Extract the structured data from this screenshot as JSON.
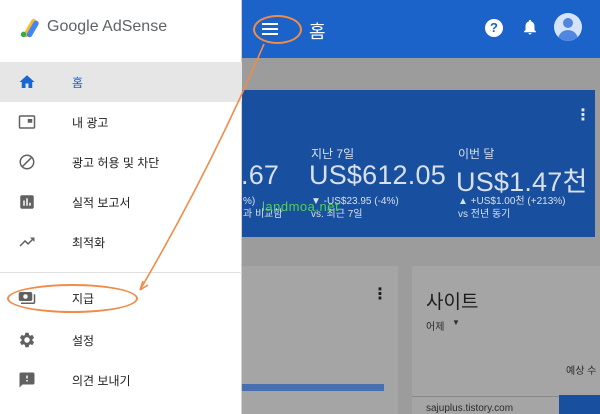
{
  "app": {
    "logo_text": "Google AdSense",
    "page_title": "홈"
  },
  "nav": {
    "items": [
      {
        "label": "홈",
        "icon": "home-icon",
        "active": true
      },
      {
        "label": "내 광고",
        "icon": "ads-icon"
      },
      {
        "label": "광고 허용 및 차단",
        "icon": "block-icon"
      },
      {
        "label": "실적 보고서",
        "icon": "report-icon"
      },
      {
        "label": "최적화",
        "icon": "trending-icon"
      },
      {
        "label": "지급",
        "icon": "payment-icon"
      },
      {
        "label": "설정",
        "icon": "settings-icon"
      },
      {
        "label": "의견 보내기",
        "icon": "feedback-icon"
      }
    ]
  },
  "stats": [
    {
      "label": "",
      "value": ".67",
      "sub1": "%)",
      "sub2": "과 비교함"
    },
    {
      "label": "지난 7일",
      "value": "US$612.05",
      "sub1": "▼ -US$23.95 (-4%)",
      "sub2": "vs. 최근 7일"
    },
    {
      "label": "이번 달",
      "value": "US$1.47천",
      "sub1": "▲ +US$1.00천 (+213%)",
      "sub2": "vs 전년 동기"
    }
  ],
  "site_card": {
    "title": "사이트",
    "period": "어제",
    "column": "예상 수",
    "row_url": "sajuplus.tistory.com"
  },
  "watermark": "landmoa.net",
  "colors": {
    "primary": "#1b62c9",
    "accent": "#ef8c49",
    "active_text": "#1a64d6"
  }
}
